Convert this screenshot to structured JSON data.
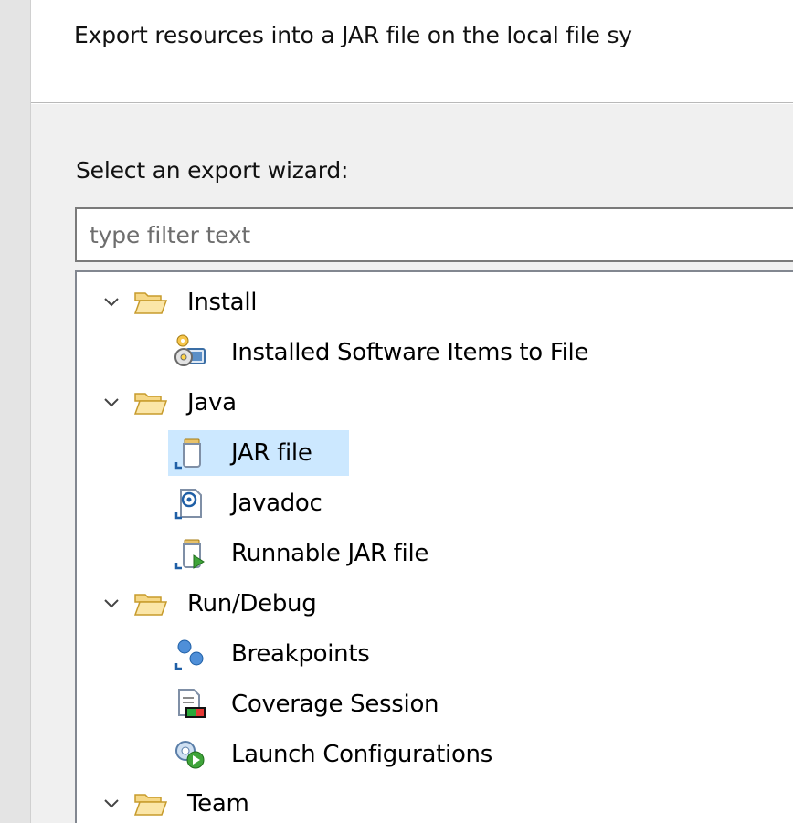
{
  "description": "Export resources into a JAR file on the local file sy",
  "wizard_label": "Select an export wizard:",
  "filter": {
    "value": "",
    "placeholder": "type filter text"
  },
  "tree": {
    "categories": [
      {
        "label": "Install",
        "expanded": true,
        "items": [
          {
            "label": "Installed Software Items to File",
            "icon": "installed-software-icon"
          }
        ]
      },
      {
        "label": "Java",
        "expanded": true,
        "items": [
          {
            "label": "JAR file",
            "icon": "jar-file-icon",
            "selected": true
          },
          {
            "label": "Javadoc",
            "icon": "javadoc-icon"
          },
          {
            "label": "Runnable JAR file",
            "icon": "runnable-jar-icon"
          }
        ]
      },
      {
        "label": "Run/Debug",
        "expanded": true,
        "items": [
          {
            "label": "Breakpoints",
            "icon": "breakpoints-icon"
          },
          {
            "label": "Coverage Session",
            "icon": "coverage-session-icon"
          },
          {
            "label": "Launch Configurations",
            "icon": "launch-configurations-icon"
          }
        ]
      },
      {
        "label": "Team",
        "expanded": true,
        "items": []
      }
    ]
  },
  "colors": {
    "selection": "#cce8ff",
    "folder": "#f6d887",
    "folder_outline": "#c79b2c"
  }
}
